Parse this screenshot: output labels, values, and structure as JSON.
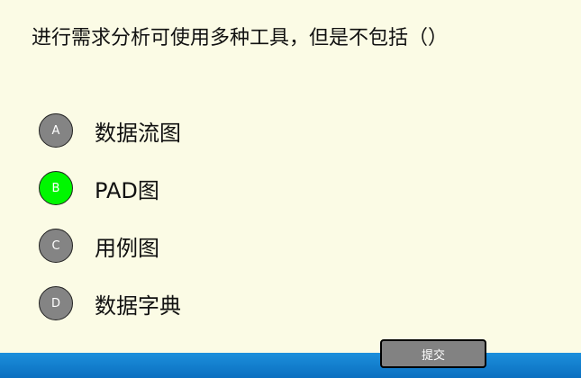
{
  "question": {
    "text": "进行需求分析可使用多种工具，但是不包括（）"
  },
  "options": [
    {
      "letter": "A",
      "text": "数据流图",
      "selected": false
    },
    {
      "letter": "B",
      "text": "PAD图",
      "selected": true
    },
    {
      "letter": "C",
      "text": "用例图",
      "selected": false
    },
    {
      "letter": "D",
      "text": "数据字典",
      "selected": false
    }
  ],
  "submit": {
    "label": "提交"
  },
  "colors": {
    "background": "#fbfbe5",
    "selected_badge": "#00f700",
    "unselected_badge": "#848484",
    "taskbar": "#1580d0"
  }
}
